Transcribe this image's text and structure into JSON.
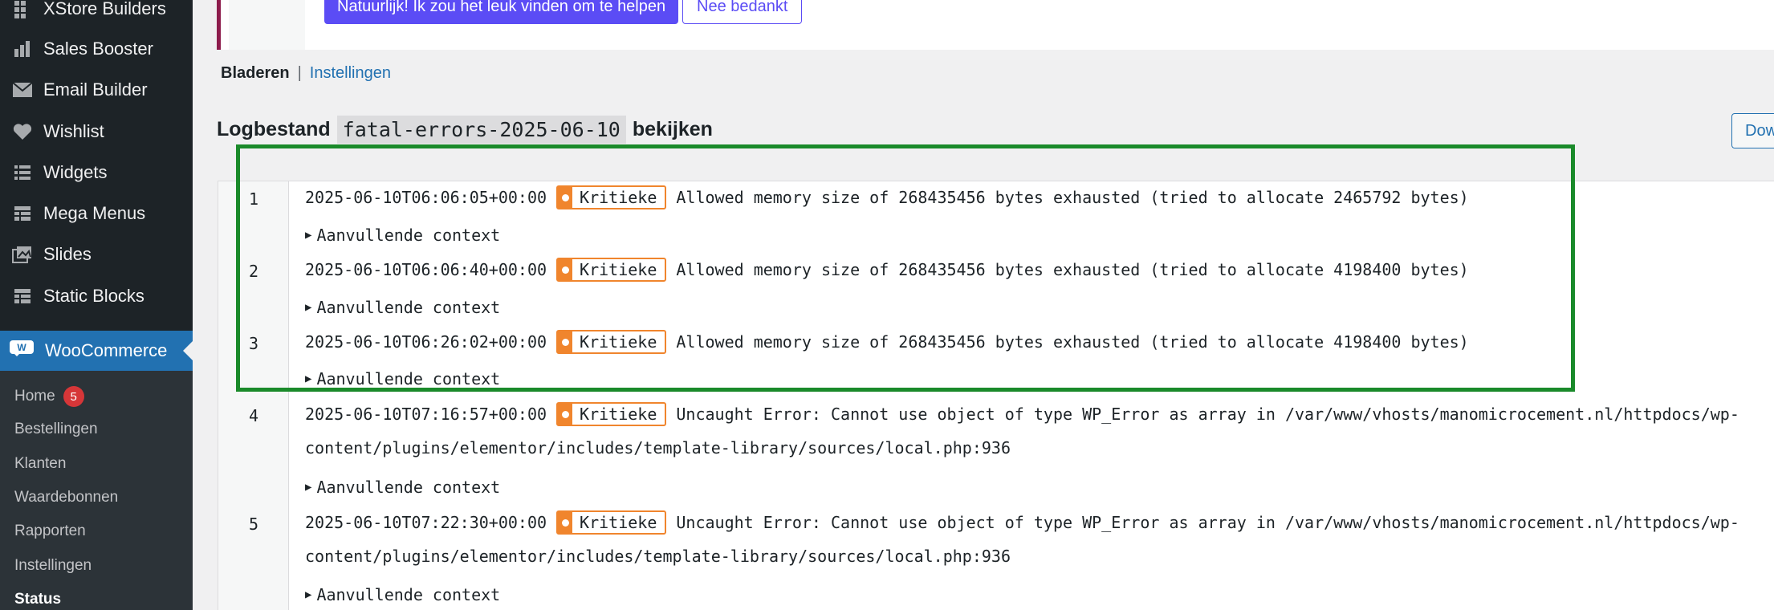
{
  "sidebar": {
    "items": [
      {
        "label": "XStore Builders",
        "icon": "grid-icon"
      },
      {
        "label": "Sales Booster",
        "icon": "bar-chart-icon"
      },
      {
        "label": "Email Builder",
        "icon": "envelope-icon"
      },
      {
        "label": "Wishlist",
        "icon": "heart-icon"
      },
      {
        "label": "Widgets",
        "icon": "list-icon"
      },
      {
        "label": "Mega Menus",
        "icon": "table-icon"
      },
      {
        "label": "Slides",
        "icon": "images-icon"
      },
      {
        "label": "Static Blocks",
        "icon": "table-icon"
      }
    ],
    "woocommerce": {
      "label": "WooCommerce",
      "icon": "W"
    },
    "submenu": {
      "home": "Home",
      "home_badge": "5",
      "orders": "Bestellingen",
      "customers": "Klanten",
      "coupons": "Waardebonnen",
      "reports": "Rapporten",
      "settings": "Instellingen",
      "status": "Status"
    }
  },
  "notice": {
    "primary_button": "Natuurlijk! Ik zou het leuk vinden om te helpen",
    "secondary_button": "Nee bedankt"
  },
  "subnav": {
    "browse": "Bladeren",
    "separator": "|",
    "settings": "Instellingen"
  },
  "title": {
    "prefix": "Logbestand",
    "filename": "fatal-errors-2025-06-10",
    "suffix": "bekijken"
  },
  "download_button": "Downloaden",
  "log": {
    "level_label": "Kritieke",
    "context_label": "Aanvullende context",
    "entries": [
      {
        "num": "1",
        "time": "2025-06-10T06:06:05+00:00",
        "message": "Allowed memory size of 268435456 bytes exhausted (tried to allocate 2465792 bytes)"
      },
      {
        "num": "2",
        "time": "2025-06-10T06:06:40+00:00",
        "message": "Allowed memory size of 268435456 bytes exhausted (tried to allocate 4198400 bytes)"
      },
      {
        "num": "3",
        "time": "2025-06-10T06:26:02+00:00",
        "message": "Allowed memory size of 268435456 bytes exhausted (tried to allocate 4198400 bytes)"
      },
      {
        "num": "4",
        "time": "2025-06-10T07:16:57+00:00",
        "message": "Uncaught Error: Cannot use object of type WP_Error as array in /var/www/vhosts/manomicrocement.nl/httpdocs/wp-",
        "message_cont": "content/plugins/elementor/includes/template-library/sources/local.php:936"
      },
      {
        "num": "5",
        "time": "2025-06-10T07:22:30+00:00",
        "message": "Uncaught Error: Cannot use object of type WP_Error as array in /var/www/vhosts/manomicrocement.nl/httpdocs/wp-",
        "message_cont": "content/plugins/elementor/includes/template-library/sources/local.php:936"
      }
    ]
  },
  "colors": {
    "sidebar_bg": "#1d2327",
    "woo_active": "#2271b1",
    "critical": "#f0852d",
    "highlight": "#1a8a2a",
    "primary_button": "#5b4cf5"
  }
}
